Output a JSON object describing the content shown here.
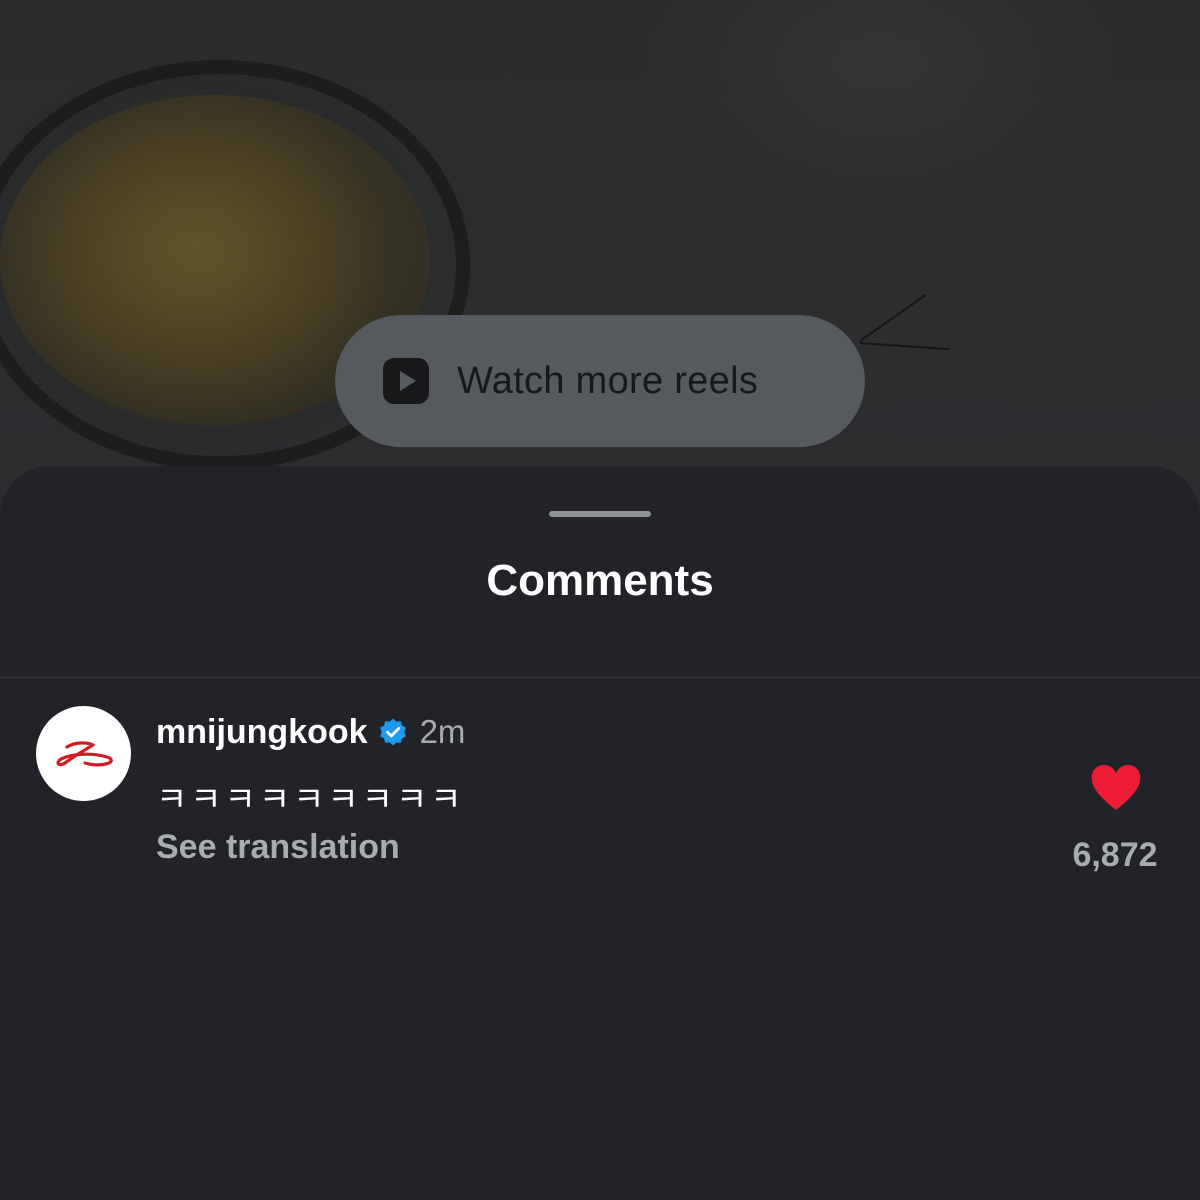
{
  "reels_prompt": {
    "label": "Watch more reels",
    "icon": "reels-play-icon"
  },
  "comments_sheet": {
    "title": "Comments"
  },
  "comments": [
    {
      "username": "mnijungkook",
      "verified": true,
      "time": "2m",
      "text": "ㅋㅋㅋㅋㅋㅋㅋㅋㅋ",
      "translate_label": "See translation",
      "like_count": "6,872",
      "liked": true
    }
  ],
  "colors": {
    "heart": "#ee1d36",
    "verified_badge": "#1d9bf0",
    "avatar_logo": "#d71921",
    "sheet_bg": "#222328"
  }
}
